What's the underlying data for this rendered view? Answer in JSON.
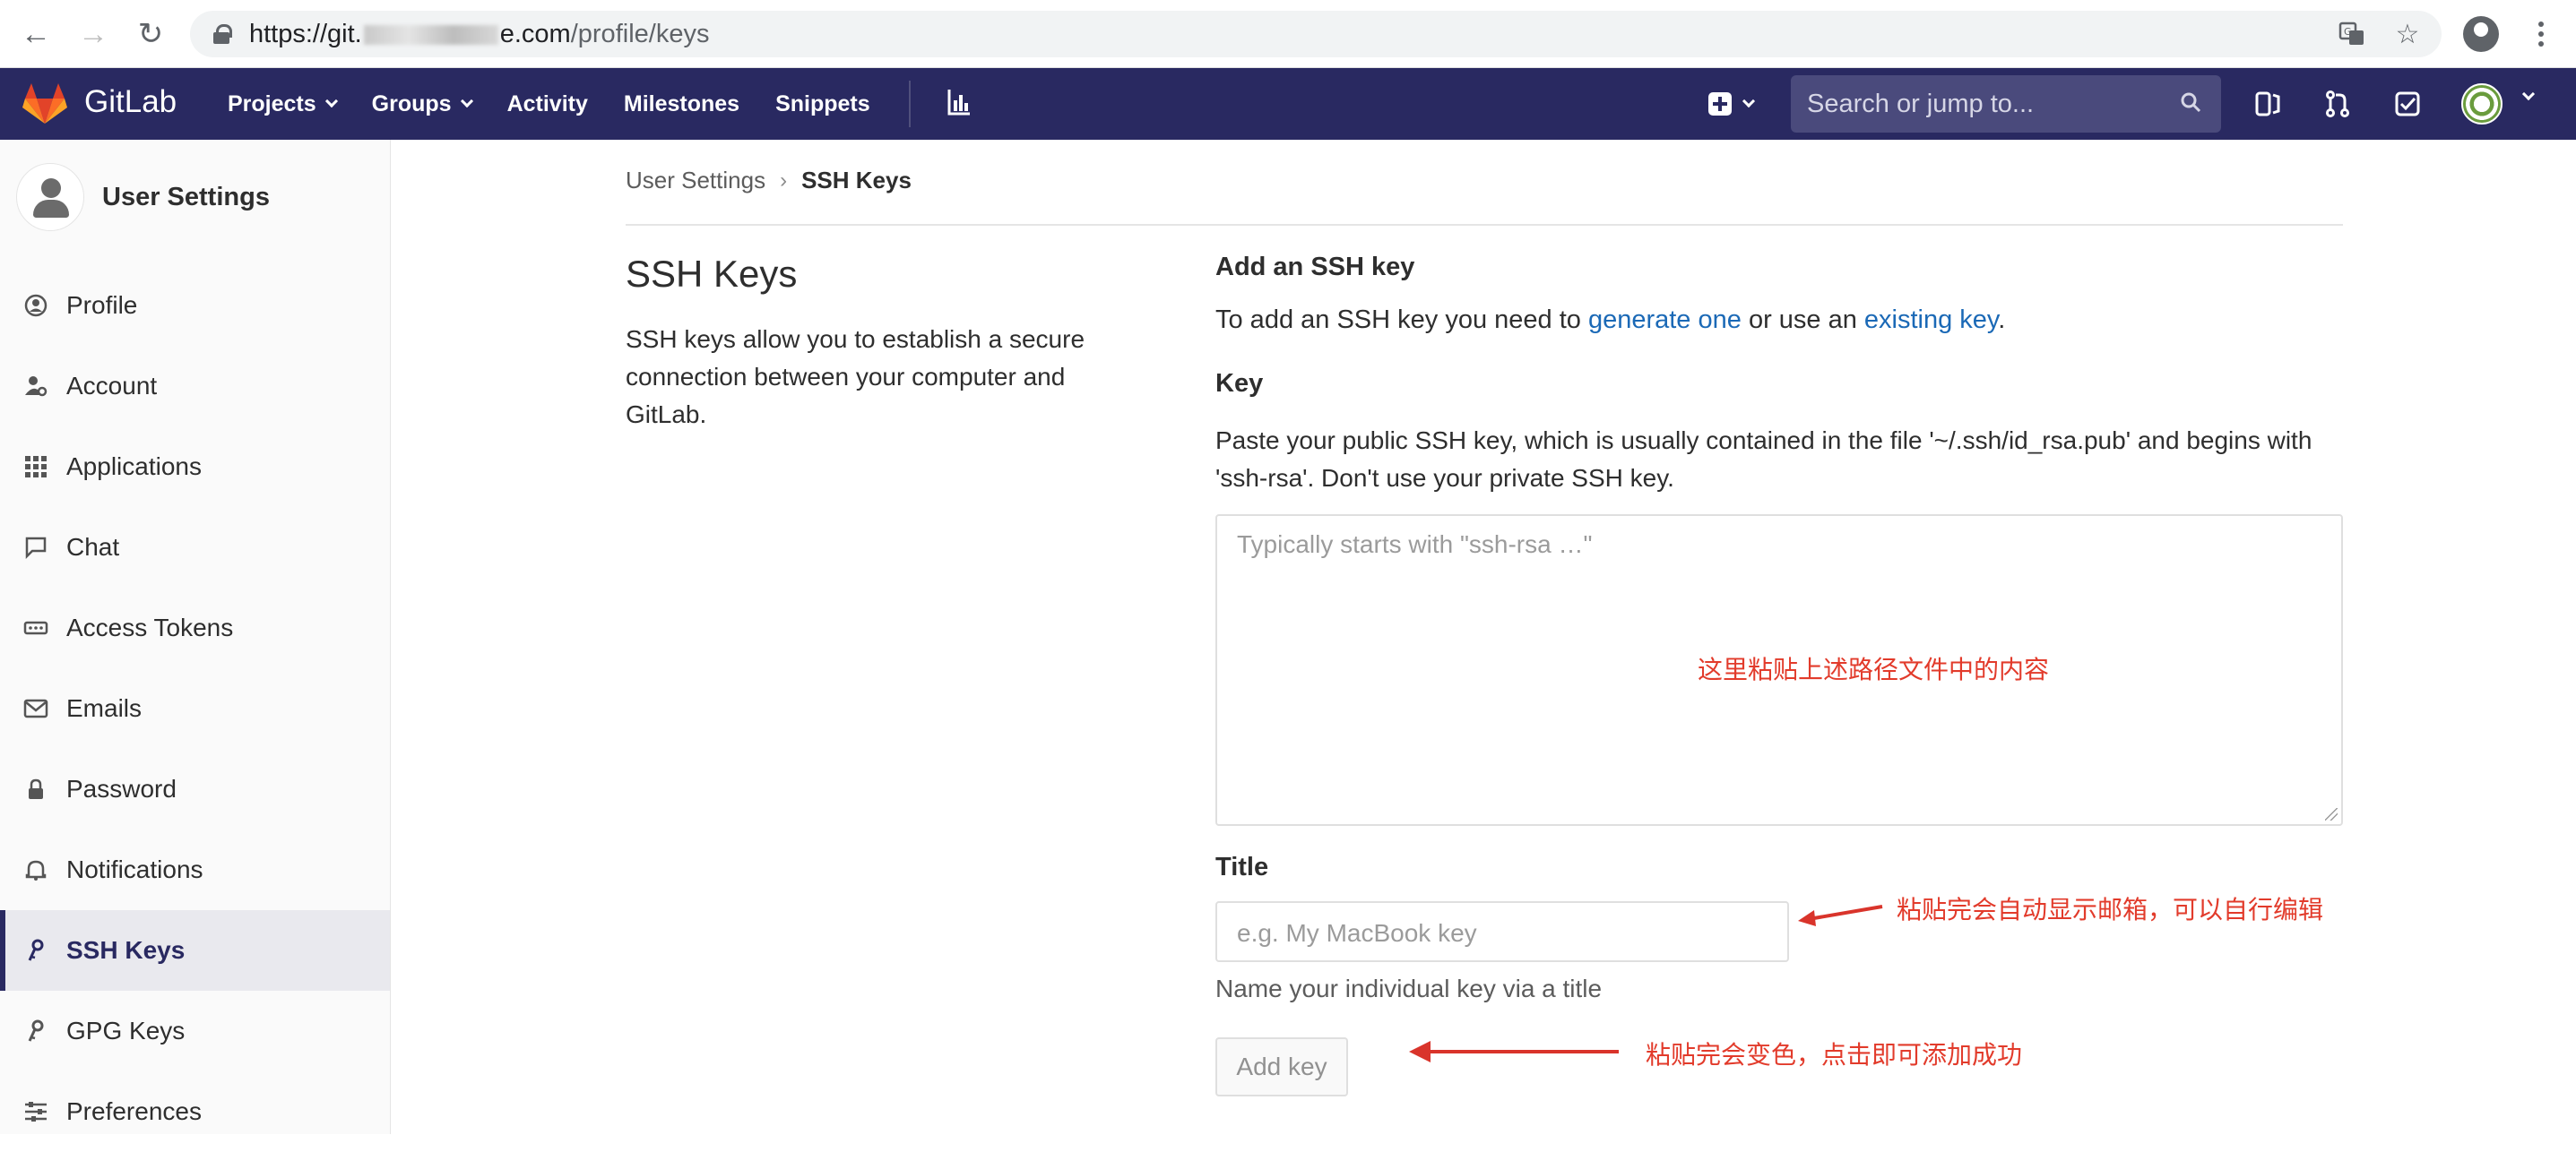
{
  "browser": {
    "url_prefix": "https://git.",
    "url_host_tail": "e.com",
    "url_path": "/profile/keys"
  },
  "header": {
    "brand": "GitLab",
    "nav": [
      {
        "label": "Projects",
        "dropdown": true
      },
      {
        "label": "Groups",
        "dropdown": true
      },
      {
        "label": "Activity",
        "dropdown": false
      },
      {
        "label": "Milestones",
        "dropdown": false
      },
      {
        "label": "Snippets",
        "dropdown": false
      }
    ],
    "search_placeholder": "Search or jump to...",
    "colors": {
      "bg": "#292961",
      "search_bg": "#4a4a7c"
    }
  },
  "sidebar": {
    "title": "User Settings",
    "items": [
      {
        "label": "Profile",
        "icon": "profile-icon",
        "active": false
      },
      {
        "label": "Account",
        "icon": "account-icon",
        "active": false
      },
      {
        "label": "Applications",
        "icon": "applications-icon",
        "active": false
      },
      {
        "label": "Chat",
        "icon": "chat-icon",
        "active": false
      },
      {
        "label": "Access Tokens",
        "icon": "access-tokens-icon",
        "active": false
      },
      {
        "label": "Emails",
        "icon": "email-icon",
        "active": false
      },
      {
        "label": "Password",
        "icon": "lock-icon",
        "active": false
      },
      {
        "label": "Notifications",
        "icon": "bell-icon",
        "active": false
      },
      {
        "label": "SSH Keys",
        "icon": "key-icon",
        "active": true
      },
      {
        "label": "GPG Keys",
        "icon": "key-icon",
        "active": false
      },
      {
        "label": "Preferences",
        "icon": "sliders-icon",
        "active": false
      }
    ]
  },
  "breadcrumb": {
    "parent": "User Settings",
    "current": "SSH Keys"
  },
  "main": {
    "title": "SSH Keys",
    "description": "SSH keys allow you to establish a secure connection between your computer and GitLab.",
    "add_heading": "Add an SSH key",
    "intro_before": "To add an SSH key you need to ",
    "intro_link1": "generate one",
    "intro_middle": " or use an ",
    "intro_link2": "existing key",
    "intro_after": ".",
    "key_label": "Key",
    "key_help": "Paste your public SSH key, which is usually contained in the file '~/.ssh/id_rsa.pub' and begins with 'ssh-rsa'. Don't use your private SSH key.",
    "key_placeholder": "Typically starts with \"ssh-rsa …\"",
    "title_label": "Title",
    "title_placeholder": "e.g. My MacBook key",
    "title_help": "Name your individual key via a title",
    "add_button": "Add key"
  },
  "annotations": {
    "key_note": "这里粘贴上述路径文件中的内容",
    "title_note": "粘贴完会自动显示邮箱，可以自行编辑",
    "button_note": "粘贴完会变色，点击即可添加成功",
    "color": "#e23b2b"
  }
}
